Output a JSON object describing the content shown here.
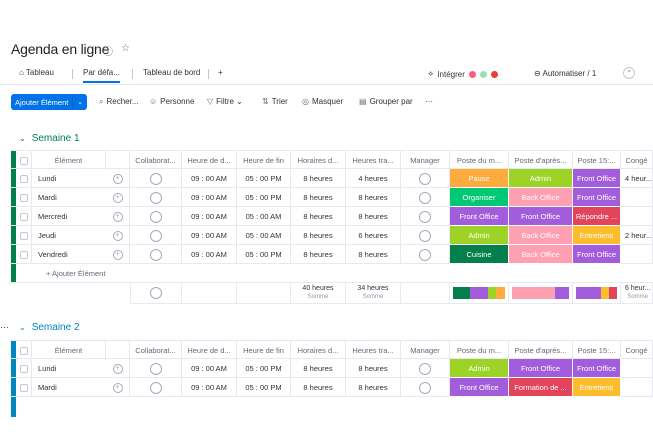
{
  "page_title": "Agenda en ligne",
  "tabs": [
    {
      "label": "Tableau",
      "icon": "home-icon"
    },
    {
      "label": "Par défa..."
    },
    {
      "label": "Tableau de bord"
    },
    {
      "label": "+"
    }
  ],
  "integrate": {
    "label": "Intégrer"
  },
  "automate": {
    "label": "Automatiser / 1"
  },
  "toolbar": {
    "add_label": "Ajouter Élément",
    "search": "Recher...",
    "person": "Personne",
    "filter": "Filtre",
    "sort": "Trier",
    "hide": "Masquer",
    "group_by": "Grouper par",
    "more": "···"
  },
  "columns": [
    "Élément",
    "Collaborat...",
    "Heure de d...",
    "Heure de fin",
    "Horaires d...",
    "Heures tra...",
    "Manager",
    "Poste du m...",
    "Poste d'aprés...",
    "Poste 15:...",
    "Congé"
  ],
  "colors": {
    "Pause": "#fdab3d",
    "Admin": "#9cd326",
    "Organiser": "#00c875",
    "Back Office": "#ff9fb2",
    "Front Office": "#a25ddc",
    "Répondre ...": "#e2445c",
    "Entretiens": "#fdbc2c",
    "Cuisine": "#037f4c",
    "Formation de ...": "#e2445c"
  },
  "group1": {
    "name": "Semaine 1",
    "rows": [
      {
        "name": "Lundi",
        "start": "09 : 00 AM",
        "end": "05 : 00 PM",
        "hours": "8 heures",
        "worked": "4 heures",
        "morning": "Pause",
        "afternoon": "Admin",
        "p15": "Front Office",
        "leave": "4 heur..."
      },
      {
        "name": "Mardi",
        "start": "09 : 00 AM",
        "end": "05 : 00 PM",
        "hours": "8 heures",
        "worked": "8 heures",
        "morning": "Organiser",
        "afternoon": "Back Office",
        "p15": "Front Office",
        "leave": ""
      },
      {
        "name": "Mercredi",
        "start": "09 : 00 AM",
        "end": "05 : 00 AM",
        "hours": "8 heures",
        "worked": "8 heures",
        "morning": "Front Office",
        "afternoon": "Front Office",
        "p15": "Répondre ...",
        "leave": ""
      },
      {
        "name": "Jeudi",
        "start": "09 : 00 AM",
        "end": "05 : 00 AM",
        "hours": "8 heures",
        "worked": "6 heures",
        "morning": "Admin",
        "afternoon": "Back Office",
        "p15": "Entretiens",
        "leave": "2 heur..."
      },
      {
        "name": "Vendredi",
        "start": "09 : 00 AM",
        "end": "05 : 00 PM",
        "hours": "8 heures",
        "worked": "8 heures",
        "morning": "Cuisine",
        "afternoon": "Back Office",
        "p15": "Front Office",
        "leave": ""
      }
    ],
    "add_item": "+ Ajouter Élément",
    "sum_hours": "40 heures",
    "sum_worked": "34 heures",
    "sum_label": "Somme",
    "sum_leave": "6 heur..."
  },
  "group2": {
    "name": "Semaine 2",
    "rows": [
      {
        "name": "Lundi",
        "start": "09 : 00 AM",
        "end": "05 : 00 PM",
        "hours": "8 heures",
        "worked": "8 heures",
        "morning": "Admin",
        "afternoon": "Front Office",
        "p15": "Front Office",
        "leave": ""
      },
      {
        "name": "Mardi",
        "start": "09 : 00 AM",
        "end": "05 : 00 PM",
        "hours": "8 heures",
        "worked": "8 heures",
        "morning": "Front Office",
        "afternoon": "Formation de ...",
        "p15": "Entretiens",
        "leave": ""
      }
    ]
  }
}
